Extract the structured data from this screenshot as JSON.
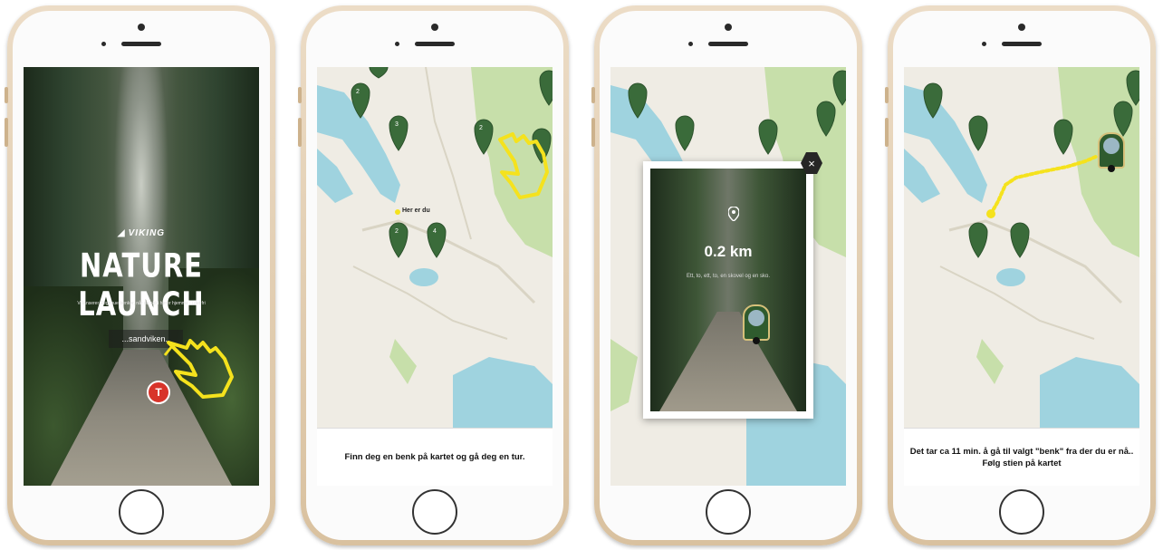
{
  "screen1": {
    "brand": "VIKING",
    "title": "NATURE LAUNCH",
    "subtitle": "Vi lanserer Regnbue-benker, når du aldri hører hjemme i i det fri",
    "location_button": "...sandviken..",
    "logo_letter": "T"
  },
  "screen2": {
    "here_label": "Her er du",
    "caption": "Finn deg en benk på kartet og gå deg en tur."
  },
  "screen3": {
    "distance": "0.2 km",
    "description": "Ett, to, ett, to, en skovel og en sko.",
    "close_symbol": "×"
  },
  "screen4": {
    "caption": "Det tar ca 11 min. å gå til valgt \"benk\" fra der du er nå.. Følg stien på kartet"
  },
  "pins": [
    {
      "label": "2"
    },
    {
      "label": "3"
    },
    {
      "label": "2"
    },
    {
      "label": "2"
    },
    {
      "label": "2"
    },
    {
      "label": "4"
    }
  ],
  "colors": {
    "map_land": "#efece4",
    "map_water": "#9fd3df",
    "map_park": "#c7dfaa",
    "marker": "#3a6b3a",
    "hand_accent": "#f5e21d",
    "route": "#f5e21d"
  },
  "icons": {
    "hand": "pointing-hand-icon",
    "pin": "map-pin-icon",
    "close": "close-icon",
    "wing": "viking-wing-icon"
  }
}
